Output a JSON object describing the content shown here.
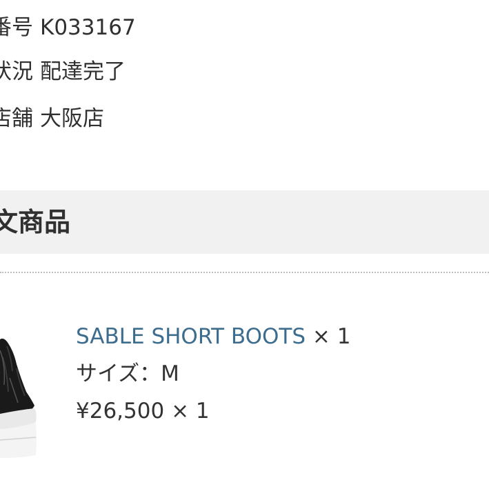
{
  "order": {
    "number_label": "番号",
    "number_value": "K033167",
    "status_label": "状況",
    "status_value": "配達完了",
    "store_label": "店舗",
    "store_value": "大阪店"
  },
  "section": {
    "title": "文商品"
  },
  "item": {
    "name": "SABLE SHORT BOOTS",
    "name_qty": "× 1",
    "size_label": "サイズ：",
    "size_value": "M",
    "price": "¥26,500",
    "price_qty": "× 1",
    "image_icon": "boot-image"
  },
  "colors": {
    "link": "#3d6d8e",
    "header_bg": "#f1f1f1",
    "text": "#333333"
  }
}
